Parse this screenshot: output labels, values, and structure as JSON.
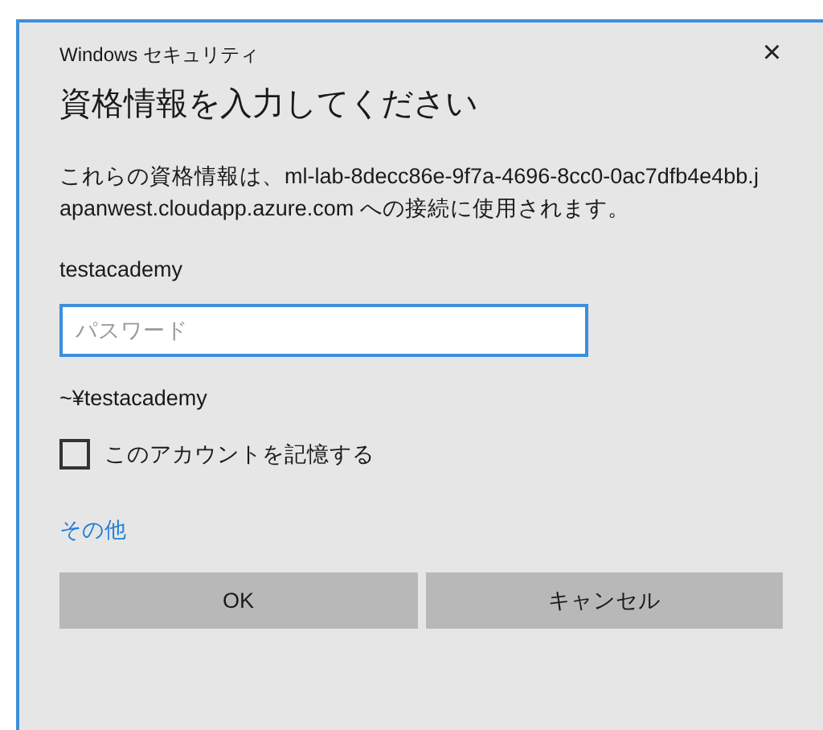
{
  "window": {
    "title": "Windows セキュリティ",
    "close": "×"
  },
  "heading": "資格情報を入力してください",
  "description": "これらの資格情報は、ml-lab-8decc86e-9f7a-4696-8cc0-0ac7dfb4e4bb.japanwest.cloudapp.azure.com への接続に使用されます。",
  "username": "testacademy",
  "password": {
    "placeholder": "パスワード",
    "focused": true
  },
  "domain": "~¥testacademy",
  "remember": {
    "label": "このアカウントを記憶する",
    "checked": false
  },
  "more_link": "その他",
  "buttons": [
    "OK",
    "キャンセル"
  ]
}
